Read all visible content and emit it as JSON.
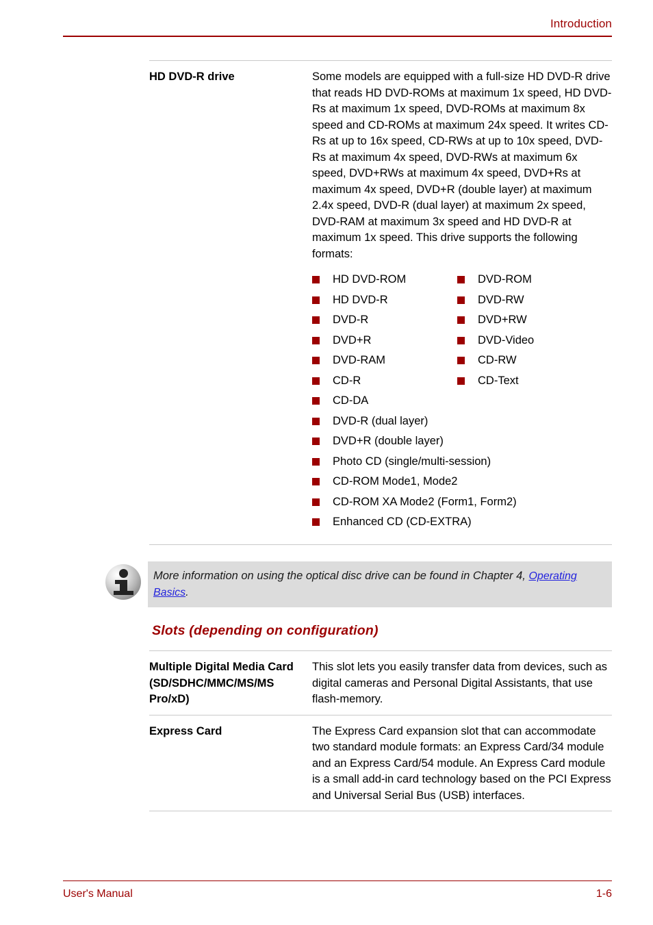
{
  "header": {
    "title": "Introduction"
  },
  "drive_section": {
    "term": "HD DVD-R drive",
    "description": "Some models are equipped with a full-size HD DVD-R drive that reads HD DVD-ROMs at maximum 1x speed, HD DVD-Rs at maximum 1x speed, DVD-ROMs at maximum 8x speed and CD-ROMs at maximum 24x speed. It writes CD-Rs at up to 16x speed, CD-RWs at up to 10x speed, DVD-Rs at maximum 4x speed, DVD-RWs at maximum 6x speed, DVD+RWs at maximum 4x speed, DVD+Rs at maximum 4x speed, DVD+R (double layer) at maximum 2.4x speed, DVD-R (dual layer) at maximum 2x speed, DVD-RAM at maximum 3x speed and HD DVD-R at maximum 1x speed. This drive supports the following formats:",
    "formats_column_left": [
      "HD DVD-ROM",
      "HD DVD-R",
      "DVD-R",
      "DVD+R",
      "DVD-RAM",
      "CD-R",
      "CD-DA",
      "DVD-R (dual layer)",
      "DVD+R (double layer)",
      "Photo CD (single/multi-session)",
      "CD-ROM Mode1, Mode2",
      "CD-ROM XA Mode2 (Form1, Form2)",
      "Enhanced CD (CD-EXTRA)"
    ],
    "formats_column_right": [
      "DVD-ROM",
      "DVD-RW",
      "DVD+RW",
      "DVD-Video",
      "CD-RW",
      "CD-Text"
    ]
  },
  "note": {
    "text_before_link": "More information on using the optical disc drive can be found in Chapter 4, ",
    "link_text": "Operating Basics",
    "text_after_link": ".",
    "icon": "info-icon",
    "background_color": "#dcdcdc",
    "link_color": "#2222dd"
  },
  "slots_section": {
    "heading": "Slots (depending on configuration)",
    "rows": [
      {
        "term": "Multiple Digital Media Card (SD/SDHC/MMC/MS/MS Pro/xD)",
        "description": "This slot lets you easily transfer data from devices, such as digital cameras and Personal Digital Assistants, that use flash-memory."
      },
      {
        "term": "Express Card",
        "description": "The Express Card expansion slot that can accommodate two standard module formats: an Express Card/34 module and an Express Card/54 module. An Express Card module is a small add-in card technology based on the PCI Express and Universal Serial Bus (USB) interfaces."
      }
    ]
  },
  "footer": {
    "manual_label": "User's Manual",
    "page_number": "1-6"
  },
  "colors": {
    "accent_red": "#9c0000",
    "bullet_red": "#9c0000",
    "rule_grey": "#c9c9c9"
  }
}
